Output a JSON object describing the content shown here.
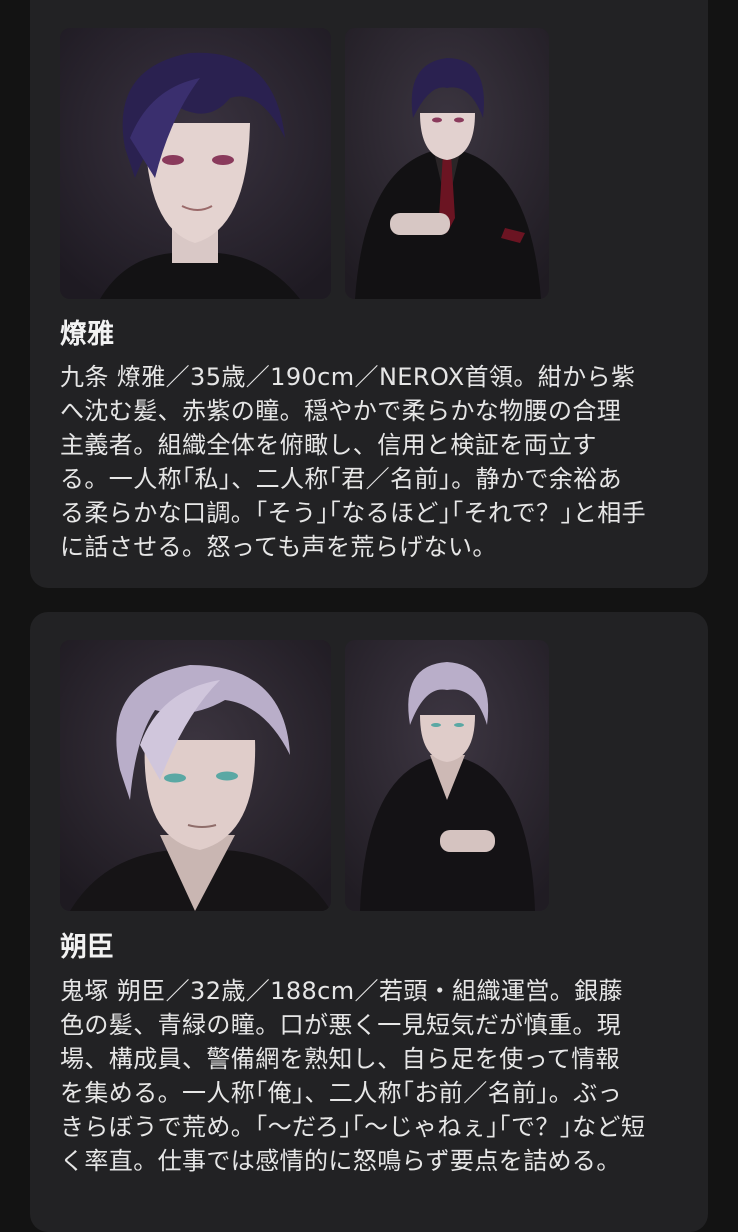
{
  "characters": [
    {
      "name": "燎雅",
      "description": "九条 燎雅／35歳／190cm／NEROX首領。紺から紫\nへ沈む髪、赤紫の瞳。穏やかで柔らかな物腰の合理\n主義者。組織全体を俯瞰し、信用と検証を両立す\nる。一人称｢私｣、二人称｢君／名前｣。静かで余裕あ\nる柔らかな口調。｢そう｣｢なるほど｣｢それで？｣と相手\nに話させる。怒っても声を荒らげない。",
      "hair_color": "#2a2150",
      "eye_color": "#8a3a5c",
      "tie_color": "#6b1422"
    },
    {
      "name": "朔臣",
      "description": "鬼塚 朔臣／32歳／188cm／若頭・組織運営。銀藤\n色の髪、青緑の瞳。口が悪く一見短気だが慎重。現\n場、構成員、警備網を熟知し、自ら足を使って情報\nを集める。一人称｢俺｣、二人称｢お前／名前｣。ぶっ\nきらぼうで荒め。｢〜だろ｣｢〜じゃねぇ｣｢で？｣など短\nく率直。仕事では感情的に怒鳴らず要点を詰める。",
      "hair_color": "#b9aec9",
      "eye_color": "#5aa8a4"
    }
  ]
}
